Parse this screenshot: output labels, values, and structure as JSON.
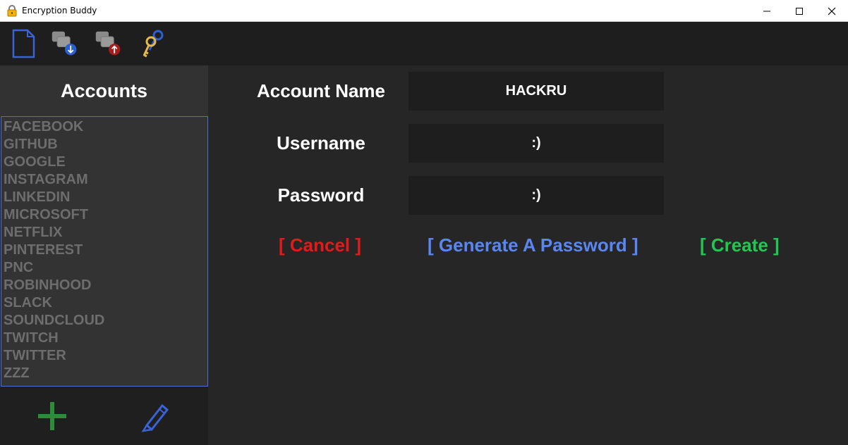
{
  "window": {
    "title": "Encryption Buddy"
  },
  "toolbar": {
    "icons": [
      "new-file-icon",
      "import-icon",
      "export-icon",
      "keys-icon"
    ]
  },
  "sidebar": {
    "header": "Accounts",
    "accounts": [
      "FACEBOOK",
      "GITHUB",
      "GOOGLE",
      "INSTAGRAM",
      "LINKEDIN",
      "MICROSOFT",
      "NETFLIX",
      "PINTEREST",
      "PNC",
      "ROBINHOOD",
      "SLACK",
      "SOUNDCLOUD",
      "TWITCH",
      "TWITTER",
      "ZZZ"
    ],
    "add_icon": "plus-icon",
    "edit_icon": "pencil-icon"
  },
  "form": {
    "account_name_label": "Account Name",
    "account_name_value": "HACKRU",
    "username_label": "Username",
    "username_value": ":)",
    "password_label": "Password",
    "password_value": ":)"
  },
  "actions": {
    "cancel": "[ Cancel ]",
    "generate": "[ Generate A Password ]",
    "create": "[ Create ]"
  },
  "colors": {
    "cancel": "#e11b1b",
    "generate": "#5a86f0",
    "create": "#23c553",
    "list_border": "#4d6ed3"
  }
}
